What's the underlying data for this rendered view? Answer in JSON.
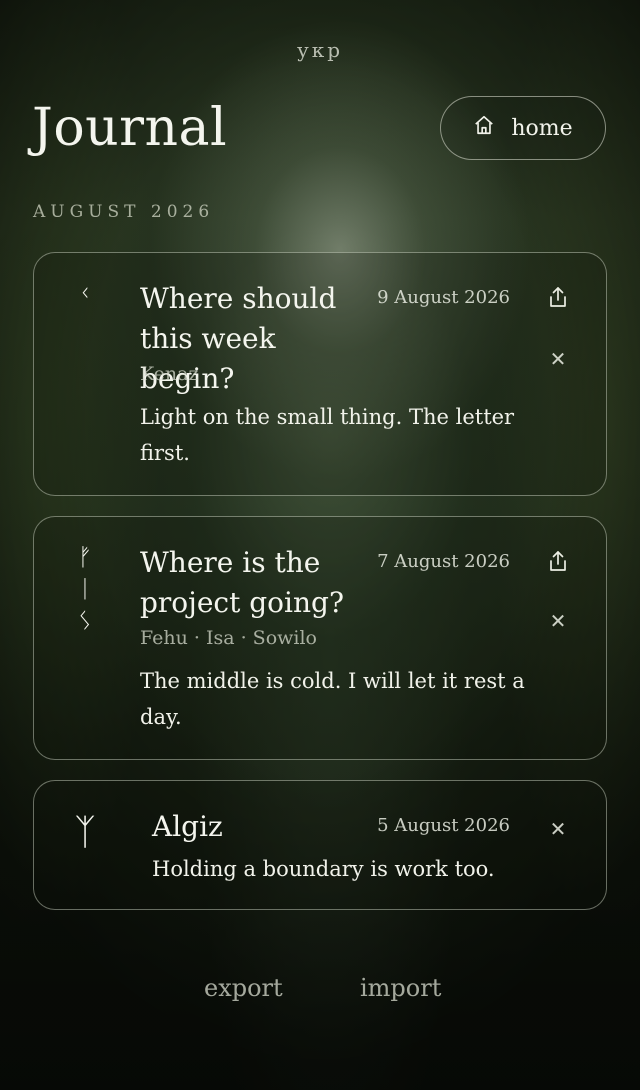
{
  "brand": "укр",
  "header": {
    "title": "Journal",
    "home_label": "home",
    "home_icon": "home-icon"
  },
  "month_label": "AUGUST 2026",
  "entries": [
    {
      "runes": [
        "ᚲ"
      ],
      "title": "Where should this week begin?",
      "date": "9 August 2026",
      "rune_names": "Kenaz",
      "text": "Light on the small thing. The letter first.",
      "share_icon": "share-icon",
      "close_icon": "close-icon"
    },
    {
      "runes": [
        "ᚠ",
        "ᛁ",
        "ᛊ"
      ],
      "title": "Where is the project going?",
      "date": "7 August 2026",
      "rune_names": "Fehu · Isa · Sowilo",
      "text": "The middle is cold. I will let it rest a day.",
      "share_icon": "share-icon",
      "close_icon": "close-icon"
    },
    {
      "runes": [
        "ᛉ"
      ],
      "title": "Algiz",
      "date": "5 August 2026",
      "text": "Holding a boundary is work too.",
      "close_icon": "close-icon"
    }
  ],
  "footer": {
    "export_label": "export",
    "import_label": "import"
  }
}
